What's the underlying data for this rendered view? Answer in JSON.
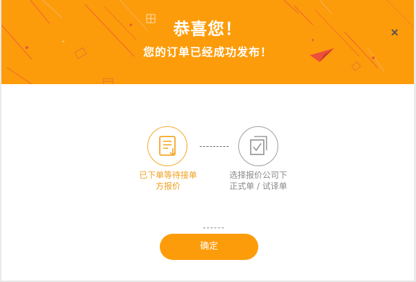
{
  "dialog": {
    "title": "恭喜您！",
    "subtitle": "您的订单已经成功发布！",
    "close_icon": "close-icon"
  },
  "steps": [
    {
      "label_line1": "已下单等待接单",
      "label_line2": "方报价",
      "status": "done",
      "icon": "document-download-icon",
      "color": "#f5a623"
    },
    {
      "label_line1": "选择报价公司下",
      "label_line2": "正式单 / 试译单",
      "status": "pending",
      "icon": "stacked-checkbox-icon",
      "color": "#9b9b9b"
    }
  ],
  "confirm_button": {
    "label": "确定"
  },
  "colors": {
    "accent": "#fd9c0a",
    "banner": "#fd9c0a",
    "step_done": "#f5a623",
    "step_pending": "#9b9b9b"
  }
}
